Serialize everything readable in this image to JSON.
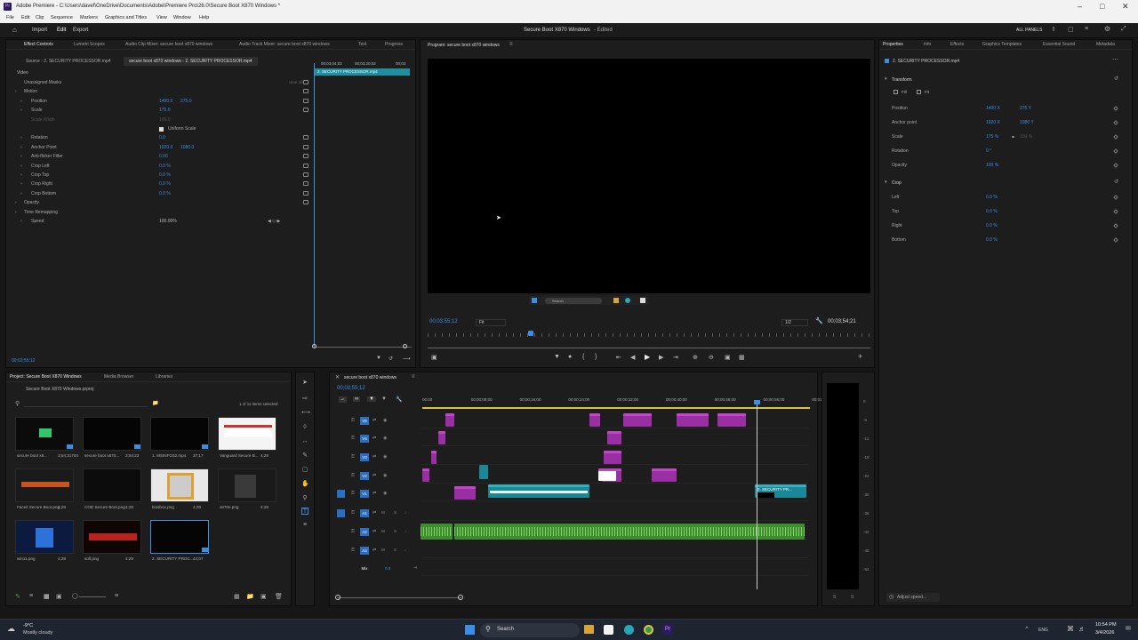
{
  "window": {
    "title": "Adobe Premiere - C:\\Users\\davef\\OneDrive\\Documents\\Adobe\\Premiere Pro\\26.0\\Secure Boot X870 Windows *"
  },
  "menu": [
    "File",
    "Edit",
    "Clip",
    "Sequence",
    "Markers",
    "Graphics and Titles",
    "View",
    "Window",
    "Help"
  ],
  "header": {
    "tabs": [
      "Import",
      "Edit",
      "Export"
    ],
    "active_tab": "Edit",
    "project_title": "Secure Boot X870 Windows",
    "status": "- Edited",
    "all_panels": "ALL PANELS"
  },
  "effect_controls": {
    "tabs": [
      "Effect Controls",
      "Lumetri Scopes",
      "Audio Clip Mixer: secure boot x870 windows",
      "Audio Track Mixer: secure boot x870 windows",
      "Text",
      "Progress"
    ],
    "source_label": "Source - 2. SECURITY PROCESSOR.mp4",
    "seq_label": "secure boot x870 windows - 2. SECURITY PROCESSOR.mp4",
    "mini_times": [
      "00;03;04;02",
      "00;03;20;02",
      "00;03"
    ],
    "mini_clip": "2. SECURITY PROCESSOR.mp4",
    "video_header": "Video",
    "rows": [
      {
        "name": "Unassigned Masks",
        "v1": "",
        "v2": ""
      },
      {
        "name": "Motion",
        "v1": "",
        "v2": ""
      },
      {
        "name": "Position",
        "v1": "1400.0",
        "v2": "275.0"
      },
      {
        "name": "Scale",
        "v1": "175.0",
        "v2": ""
      },
      {
        "name": "Scale Width",
        "v1": "100.0",
        "v2": ""
      },
      {
        "name": "",
        "v1": "Uniform Scale",
        "v2": ""
      },
      {
        "name": "Rotation",
        "v1": "0.0",
        "v2": ""
      },
      {
        "name": "Anchor Point",
        "v1": "1920.0",
        "v2": "1080.0"
      },
      {
        "name": "Anti-flicker Filter",
        "v1": "0.00",
        "v2": ""
      },
      {
        "name": "Crop Left",
        "v1": "0.0 %",
        "v2": ""
      },
      {
        "name": "Crop Top",
        "v1": "0.0 %",
        "v2": ""
      },
      {
        "name": "Crop Right",
        "v1": "0.0 %",
        "v2": ""
      },
      {
        "name": "Crop Bottom",
        "v1": "0.0 %",
        "v2": ""
      },
      {
        "name": "Opacity",
        "v1": "",
        "v2": ""
      },
      {
        "name": "Time Remapping",
        "v1": "",
        "v2": ""
      },
      {
        "name": "Speed",
        "v1": "100.00%",
        "v2": ""
      }
    ],
    "clear_all": "clear all",
    "timecode": "00;03;55;12"
  },
  "program": {
    "label": "Program: secure boot x870 windows",
    "timecode_left": "00;03;55;12",
    "fit": "Fit",
    "quality": "1/2",
    "timecode_right": "00;03;54;21",
    "taskbar_search": "Search"
  },
  "properties": {
    "tabs": [
      "Properties",
      "Info",
      "Effects",
      "Graphics Templates",
      "Essential Sound",
      "Metadata"
    ],
    "clip_name": "2. SECURITY PROCESSOR.mp4",
    "transform_label": "Transform",
    "fill_labels": [
      "Fill",
      "Fit"
    ],
    "rows": [
      {
        "name": "Position",
        "v1": "1400 X",
        "v2": "275 Y"
      },
      {
        "name": "Anchor point",
        "v1": "1920 X",
        "v2": "1080 Y"
      },
      {
        "name": "Scale",
        "v1": "175 %",
        "v2": "100 %"
      },
      {
        "name": "Rotation",
        "v1": "0 °",
        "v2": ""
      },
      {
        "name": "Opacity",
        "v1": "100 %",
        "v2": ""
      }
    ],
    "crop_label": "Crop",
    "crop_rows": [
      {
        "name": "Left",
        "v": "0.0 %"
      },
      {
        "name": "Top",
        "v": "0.0 %"
      },
      {
        "name": "Right",
        "v": "0.0 %"
      },
      {
        "name": "Bottom",
        "v": "0.0 %"
      }
    ],
    "adjust_speed": "Adjust speed..."
  },
  "project": {
    "tabs": [
      "Project: Secure Boot X870 Windows",
      "Media Browser",
      "Libraries"
    ],
    "file": "Secure Boot X870 Windows.prproj",
    "selection": "1 of 11 items selected",
    "items": [
      {
        "name": "secure boot x8...",
        "dur": "3;54;31704"
      },
      {
        "name": "secure boot x870...",
        "dur": "3;54;23"
      },
      {
        "name": "1. MSINFO32.mp4",
        "dur": "37;17"
      },
      {
        "name": "Vanguard Secure B...",
        "dur": "4;29"
      },
      {
        "name": "Faceit Secure Boot.png",
        "dur": "4;29"
      },
      {
        "name": "COD Secure Boot.png",
        "dur": "4;29"
      },
      {
        "name": "biosbox.png",
        "dur": "4;29"
      },
      {
        "name": "x870e.png",
        "dur": "4;29"
      },
      {
        "name": "win11.png",
        "dur": "4;29"
      },
      {
        "name": "sofl.png",
        "dur": "4;29"
      },
      {
        "name": "2. SECURITY PROC...",
        "dur": "44;07"
      }
    ]
  },
  "timeline": {
    "seq_name": "secure boot x870 windows",
    "timecode": "00;03;55;12",
    "ruler": [
      "00;00",
      "00;00;08;00",
      "00;00;16;00",
      "00;00;24;00",
      "00;00;32;00",
      "00;00;40;00",
      "00;00;48;00",
      "00;00;56;00",
      "00;01"
    ],
    "tracks": [
      "V6",
      "V4",
      "V3",
      "V2",
      "V1",
      "A1",
      "A2",
      "A3",
      "Mix"
    ],
    "mix_value": "0.0",
    "clip_label": "2. SECURITY PR...",
    "fx": "fx"
  },
  "meter": {
    "scale": [
      "0",
      "-6",
      "-12",
      "-18",
      "-24",
      "-30",
      "-36",
      "-42",
      "-48",
      "-54"
    ],
    "solo": [
      "S",
      "S"
    ]
  },
  "taskbar": {
    "weather_temp": "-9°C",
    "weather_desc": "Mostly cloudy",
    "search": "Search",
    "lang": "ENG",
    "time": "10:54 PM",
    "date": "3/4/2026"
  },
  "colors": {
    "accent": "#3b8ee6",
    "clip_magenta": "#9a2fa3",
    "clip_cyan": "#1a8896",
    "audio_green": "#3f8e2c"
  }
}
